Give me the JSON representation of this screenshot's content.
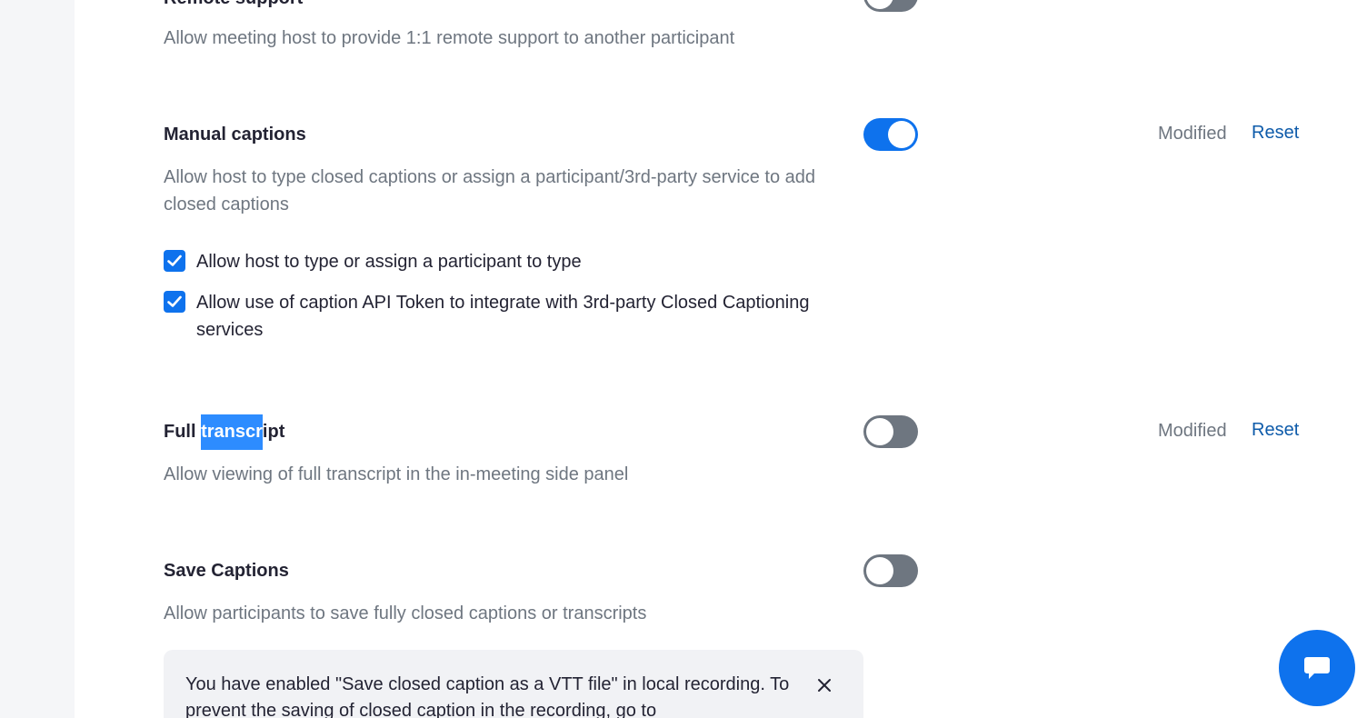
{
  "settings": {
    "remote_support": {
      "title": "Remote support",
      "description": "Allow meeting host to provide 1:1 remote support to another participant",
      "enabled": false
    },
    "manual_captions": {
      "title": "Manual captions",
      "description": "Allow host to type closed captions or assign a participant/3rd-party service to add closed captions",
      "enabled": true,
      "status": "Modified",
      "reset_label": "Reset",
      "options": [
        {
          "label": "Allow host to type or assign a participant to type",
          "checked": true
        },
        {
          "label": "Allow use of caption API Token to integrate with 3rd-party Closed Captioning services",
          "checked": true
        }
      ]
    },
    "full_transcript": {
      "title_before": "Full ",
      "title_highlight": "transcr",
      "title_after": "ipt",
      "description": "Allow viewing of full transcript in the in-meeting side panel",
      "enabled": false,
      "status": "Modified",
      "reset_label": "Reset"
    },
    "save_captions": {
      "title": "Save Captions",
      "description": "Allow participants to save fully closed captions or transcripts",
      "enabled": false,
      "notice": "You have enabled \"Save closed caption as a VTT file\" in local recording. To prevent the saving of closed caption in the recording, go to"
    }
  },
  "icons": {
    "checkbox": "checkmark-icon",
    "close": "close-icon",
    "chat": "chat-bubble-icon"
  },
  "colors": {
    "accent": "#0e72ed",
    "toggle_off": "#6e7680",
    "link": "#0e5baa",
    "selection": "#2d8cff"
  }
}
